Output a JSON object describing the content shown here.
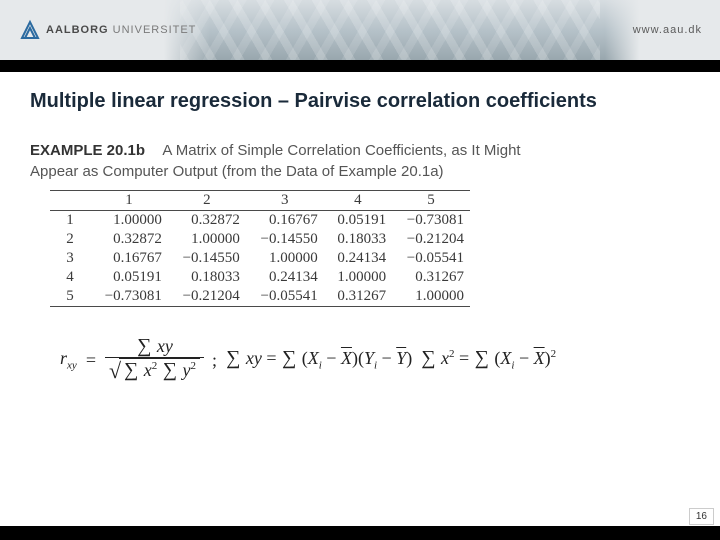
{
  "brand": {
    "uni_bold": "AALBORG",
    "uni_light": " UNIVERSITET",
    "url": "www.aau.dk"
  },
  "title": "Multiple linear regression – Pairvise correlation coefficients",
  "example": {
    "label": "EXAMPLE 20.1b",
    "heading_l1": "A Matrix of Simple Correlation Coefficients, as It Might",
    "heading_l2": "Appear as Computer Output (from the Data of Example 20.1a)"
  },
  "chart_data": {
    "type": "table",
    "title": "A Matrix of Simple Correlation Coefficients",
    "columns": [
      "1",
      "2",
      "3",
      "4",
      "5"
    ],
    "rows": [
      "1",
      "2",
      "3",
      "4",
      "5"
    ],
    "values": [
      [
        "1.00000",
        "0.32872",
        "0.16767",
        "0.05191",
        "−0.73081"
      ],
      [
        "0.32872",
        "1.00000",
        "−0.14550",
        "0.18033",
        "−0.21204"
      ],
      [
        "0.16767",
        "−0.14550",
        "1.00000",
        "0.24134",
        "−0.05541"
      ],
      [
        "0.05191",
        "0.18033",
        "0.24134",
        "1.00000",
        "0.31267"
      ],
      [
        "−0.73081",
        "−0.21204",
        "−0.05541",
        "0.31267",
        "1.00000"
      ]
    ]
  },
  "formula": {
    "lhs_var": "r",
    "lhs_sub": "xy",
    "equals": "=",
    "num": "∑ xy",
    "den_x": "∑ x²",
    "den_y": "∑ y²",
    "semicolon": ";",
    "sum_xy_lhs": "∑ xy",
    "eq2": "=",
    "term_sum_open": "∑",
    "Xi": "X",
    "i": "i",
    "minus": "−",
    "Xbar": "X",
    "Yi": "Y",
    "Ybar": "Y",
    "sum_x2_lhs": "∑ x²",
    "sq": "2"
  },
  "page_number": "16"
}
